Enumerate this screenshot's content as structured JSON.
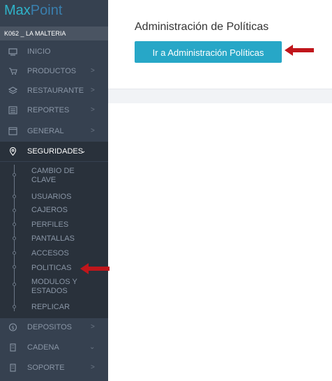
{
  "brand": {
    "part1": "Max",
    "part2": "Point"
  },
  "store_label": "K062 _ LA MALTERIA",
  "menu": [
    {
      "label": "INICIO",
      "icon": "monitor-icon",
      "chevron": ""
    },
    {
      "label": "PRODUCTOS",
      "icon": "cart-icon",
      "chevron": ">"
    },
    {
      "label": "RESTAURANTE",
      "icon": "layers-icon",
      "chevron": ">"
    },
    {
      "label": "REPORTES",
      "icon": "report-icon",
      "chevron": ">"
    },
    {
      "label": "GENERAL",
      "icon": "window-icon",
      "chevron": ">"
    },
    {
      "label": "SEGURIDADES",
      "icon": "location-pin-icon",
      "chevron": "⌄"
    },
    {
      "label": "DEPOSITOS",
      "icon": "coin-icon",
      "chevron": ">"
    },
    {
      "label": "CADENA",
      "icon": "building-icon",
      "chevron": "⌄"
    },
    {
      "label": "SOPORTE",
      "icon": "building-icon",
      "chevron": ">"
    }
  ],
  "submenu": [
    "CAMBIO DE CLAVE",
    "USUARIOS",
    "CAJEROS",
    "PERFILES",
    "PANTALLAS",
    "ACCESOS",
    "POLITICAS",
    "MODULOS Y ESTADOS",
    "REPLICAR"
  ],
  "page": {
    "title": "Administración de Políticas",
    "button_label": "Ir a Administración Políticas"
  },
  "colors": {
    "arrow": "#c0161b",
    "button": "#27a7c7",
    "sidebar": "#364150"
  }
}
